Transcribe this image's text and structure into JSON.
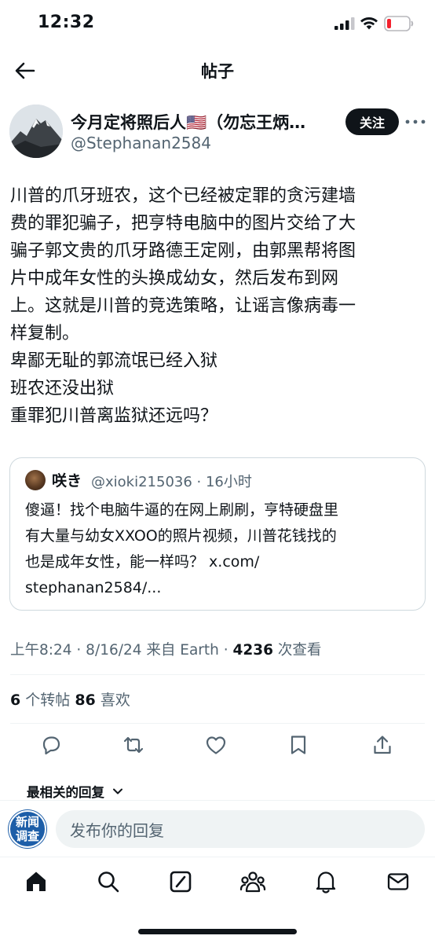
{
  "status_bar": {
    "time": "12:32"
  },
  "header": {
    "title": "帖子"
  },
  "author": {
    "display_name": "今月定将照后人🇺🇸（勿忘王炳…",
    "handle": "@Stephanan2584",
    "follow_label": "关注"
  },
  "post": {
    "lines": [
      "川普的爪牙班农，这个已经被定罪的贪污建墙",
      "费的罪犯骗子，把亨特电脑中的图片交给了大",
      "骗子郭文贵的爪牙路德王定刚，由郭黑帮将图",
      "片中成年女性的头换成幼女，然后发布到网",
      "上。这就是川普的竞选策略，让谣言像病毒一",
      "样复制。",
      "卑鄙无耻的郭流氓已经入狱",
      "班农还没出狱",
      "重罪犯川普离监狱还远吗？"
    ]
  },
  "quote": {
    "name": "咲き",
    "meta": "@xioki215036 · 16小时",
    "lines": [
      "傻逼！找个电脑牛逼的在网上刷刷，亨特硬盘里",
      "有大量与幼女XXOO的照片视频，川普花钱找的",
      "也是成年女性，能一样吗？ x.com/",
      "stephanan2584/..."
    ]
  },
  "meta": {
    "timestamp": "上午8:24 · 8/16/24 来自 Earth · ",
    "views_count": "4236",
    "views_label": " 次查看"
  },
  "stats": {
    "reposts_count": "6",
    "reposts_label": " 个转帖  ",
    "likes_count": "86",
    "likes_label": " 喜欢"
  },
  "replies": {
    "sort_label": "最相关的回复",
    "reply_avatar_top": "新闻",
    "reply_avatar_bottom": "调查",
    "reply_placeholder": "发布你的回复"
  },
  "icons": {
    "actions": [
      "reply-icon",
      "repost-icon",
      "like-icon",
      "bookmark-icon",
      "share-icon"
    ],
    "tabs": [
      "home-icon",
      "search-icon",
      "grok-icon",
      "communities-icon",
      "notifications-icon",
      "messages-icon"
    ]
  },
  "colors": {
    "text": "#0f1419",
    "secondary": "#536471",
    "border": "#cfd9de",
    "battery_low": "#f4212e"
  }
}
